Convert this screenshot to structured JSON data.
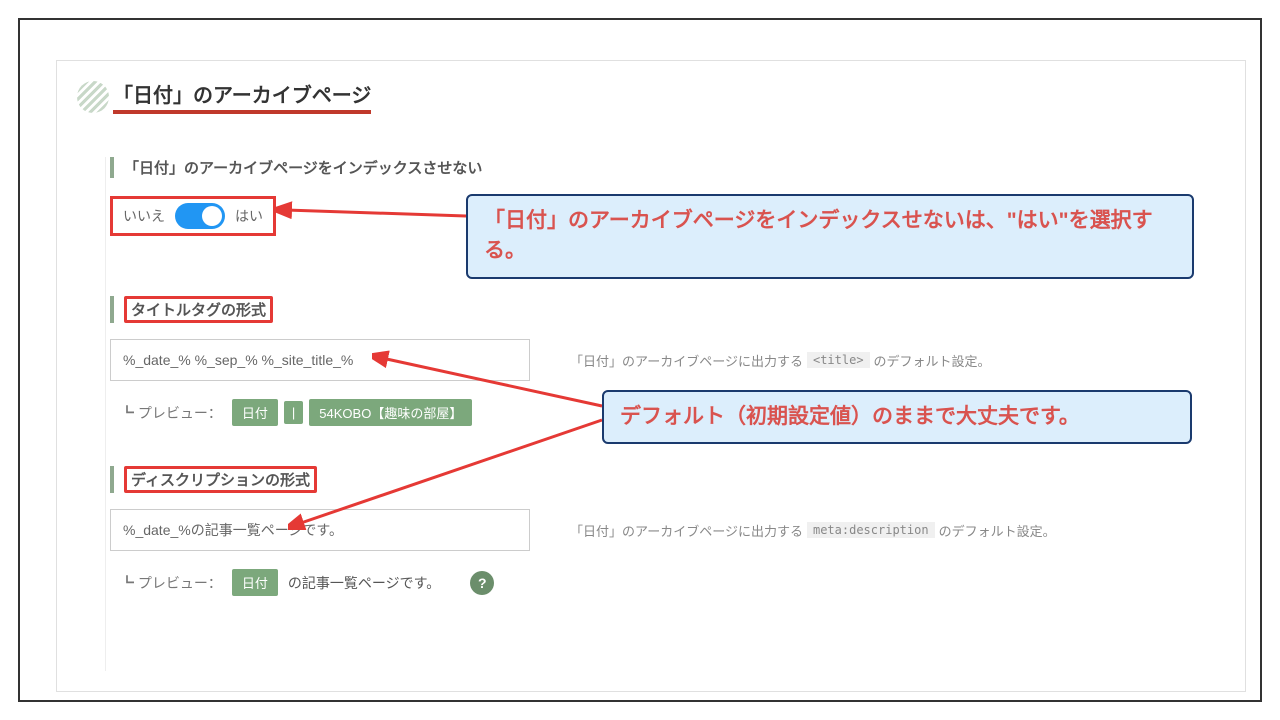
{
  "page_title": "「日付」のアーカイブページ",
  "sections": {
    "noindex": {
      "label": "「日付」のアーカイブページをインデックスさせない",
      "off": "いいえ",
      "on": "はい"
    },
    "title_tag": {
      "label": "タイトルタグの形式",
      "value": "%_date_% %_sep_% %_site_title_%",
      "desc_pre": "「日付」のアーカイブページに出力する",
      "desc_code": "<title>",
      "desc_post": "のデフォルト設定。",
      "preview_label": "┗ プレビュー：",
      "preview_pill_date": "日付",
      "preview_pill_sep": "|",
      "preview_pill_site": "54KOBO【趣味の部屋】"
    },
    "description": {
      "label": "ディスクリプションの形式",
      "value": "%_date_%の記事一覧ページです。",
      "desc_pre": "「日付」のアーカイブページに出力する",
      "desc_code": "meta:description",
      "desc_post": "のデフォルト設定。",
      "preview_label": "┗ プレビュー：",
      "preview_pill_date": "日付",
      "preview_text": "の記事一覧ページです。",
      "help": "?"
    }
  },
  "callouts": {
    "c1": "「日付」のアーカイブページをインデックスせないは、\"はい\"を選択する。",
    "c2": "デフォルト（初期設定値）のままで大丈夫です。"
  }
}
